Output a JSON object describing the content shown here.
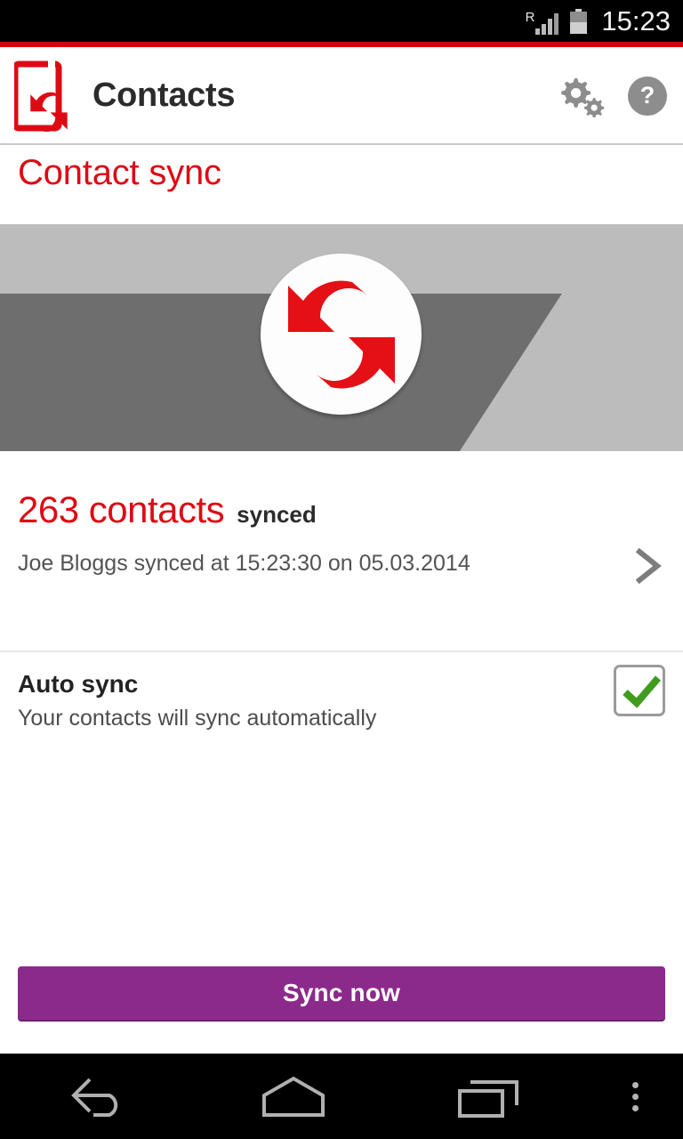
{
  "status_bar": {
    "roaming_indicator": "R",
    "signal_icon": "signal-bars-icon",
    "battery_icon": "battery-icon",
    "time": "15:23"
  },
  "app_bar": {
    "logo_icon": "contacts-sync-logo-icon",
    "title": "Contacts",
    "settings_icon": "gears-icon",
    "help_label": "?"
  },
  "page": {
    "title": "Contact sync",
    "accent_red": "#dd0a14",
    "hero": {
      "icon": "sync-arrows-icon",
      "background_color": "#bcbcbc",
      "shadow_color": "#6e6e6e"
    },
    "sync_status": {
      "count": "263 contacts",
      "state": "synced",
      "detail": "Joe Bloggs synced at 15:23:30 on 05.03.2014",
      "chevron_icon": "chevron-right-icon"
    },
    "auto_sync": {
      "title": "Auto sync",
      "subtitle": "Your contacts will sync automatically",
      "checked": true,
      "check_icon": "check-icon",
      "check_color": "#3f9c1e"
    },
    "primary_action": {
      "label": "Sync now",
      "color": "#8c2a8c"
    }
  },
  "nav_bar": {
    "back_icon": "back-arrow-icon",
    "home_icon": "home-icon",
    "recents_icon": "recents-icon",
    "more_icon": "overflow-menu-icon"
  }
}
